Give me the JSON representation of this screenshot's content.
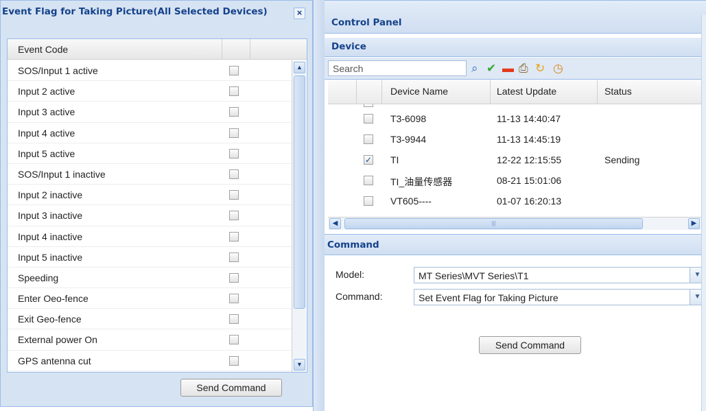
{
  "dialog": {
    "title": "Event Flag for Taking Picture(All Selected Devices)",
    "close_label": "×",
    "column_header": "Event Code",
    "events": [
      {
        "label": "SOS/Input 1 active",
        "checked": false
      },
      {
        "label": "Input 2 active",
        "checked": false
      },
      {
        "label": "Input 3 active",
        "checked": false
      },
      {
        "label": "Input 4 active",
        "checked": false
      },
      {
        "label": "Input 5 active",
        "checked": false
      },
      {
        "label": "SOS/Input 1 inactive",
        "checked": false
      },
      {
        "label": "Input 2 inactive",
        "checked": false
      },
      {
        "label": "Input 3 inactive",
        "checked": false
      },
      {
        "label": "Input 4 inactive",
        "checked": false
      },
      {
        "label": "Input 5 inactive",
        "checked": false
      },
      {
        "label": "Speeding",
        "checked": false
      },
      {
        "label": "Enter Oeo-fence",
        "checked": false
      },
      {
        "label": "Exit Geo-fence",
        "checked": false
      },
      {
        "label": "External power On",
        "checked": false
      },
      {
        "label": "GPS antenna cut",
        "checked": false
      }
    ],
    "send_label": "Send Command"
  },
  "control_panel": {
    "title": "Control Panel",
    "device": {
      "title": "Device",
      "search_placeholder": "Search",
      "toolbar_icons": [
        "search-icon",
        "check-icon",
        "minus-icon",
        "printer-icon",
        "refresh-icon",
        "clock-icon"
      ],
      "columns": [
        "Device Name",
        "Latest Update",
        "Status"
      ],
      "rows": [
        {
          "name": "T3-6098",
          "update": "11-13 14:40:47",
          "status": "",
          "checked": false
        },
        {
          "name": "T3-9944",
          "update": "11-13 14:45:19",
          "status": "",
          "checked": false
        },
        {
          "name": "TI",
          "update": "12-22 12:15:55",
          "status": "Sending",
          "checked": true
        },
        {
          "name": "TI_油量传感器",
          "update": "08-21 15:01:06",
          "status": "",
          "checked": false
        },
        {
          "name": "VT605----",
          "update": "01-07 16:20:13",
          "status": "",
          "checked": false
        }
      ]
    },
    "command": {
      "title": "Command",
      "model_label": "Model:",
      "model_value": "MT Series\\MVT Series\\T1",
      "command_label": "Command:",
      "command_value": "Set Event Flag for Taking Picture",
      "send_label": "Send Command"
    }
  }
}
